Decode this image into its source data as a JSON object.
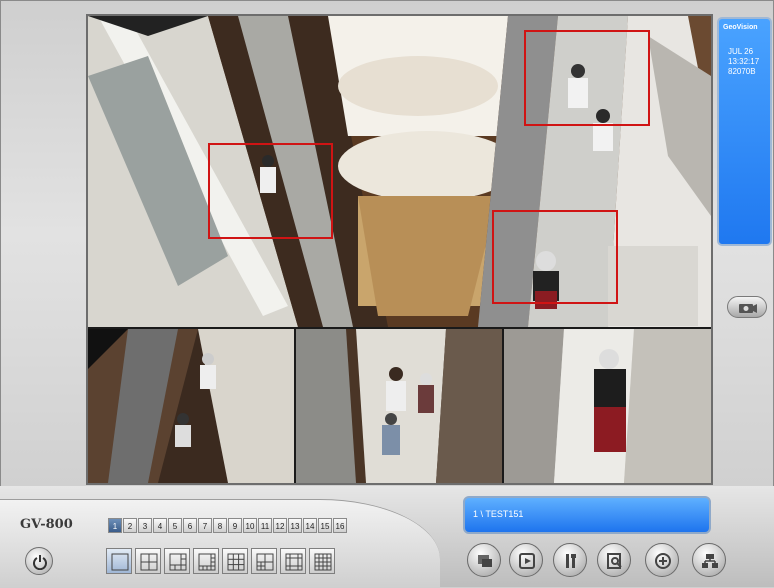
{
  "app": {
    "model": "GV-800",
    "logo": "GeoVision"
  },
  "info_panel": {
    "date": "JUL 26",
    "time": "13:32:17",
    "space": "82070B"
  },
  "status": {
    "camera_label": "1 \\ TEST151"
  },
  "channels": [
    "1",
    "2",
    "3",
    "4",
    "5",
    "6",
    "7",
    "8",
    "9",
    "10",
    "11",
    "12",
    "13",
    "14",
    "15",
    "16"
  ],
  "active_channel": "1",
  "layouts": [
    "single-view",
    "quad-view",
    "six-view",
    "eight-view",
    "nine-view",
    "ten-view",
    "thirteen-view",
    "sixteen-view"
  ],
  "function_buttons": [
    "camera-setup-icon",
    "playback-icon",
    "tools-icon",
    "search-icon",
    "network-icon",
    "exit-icon"
  ],
  "colors": {
    "panel_blue": "#2f8cff",
    "motion_box": "#d01414",
    "active_channel": "#3a5c8a"
  }
}
